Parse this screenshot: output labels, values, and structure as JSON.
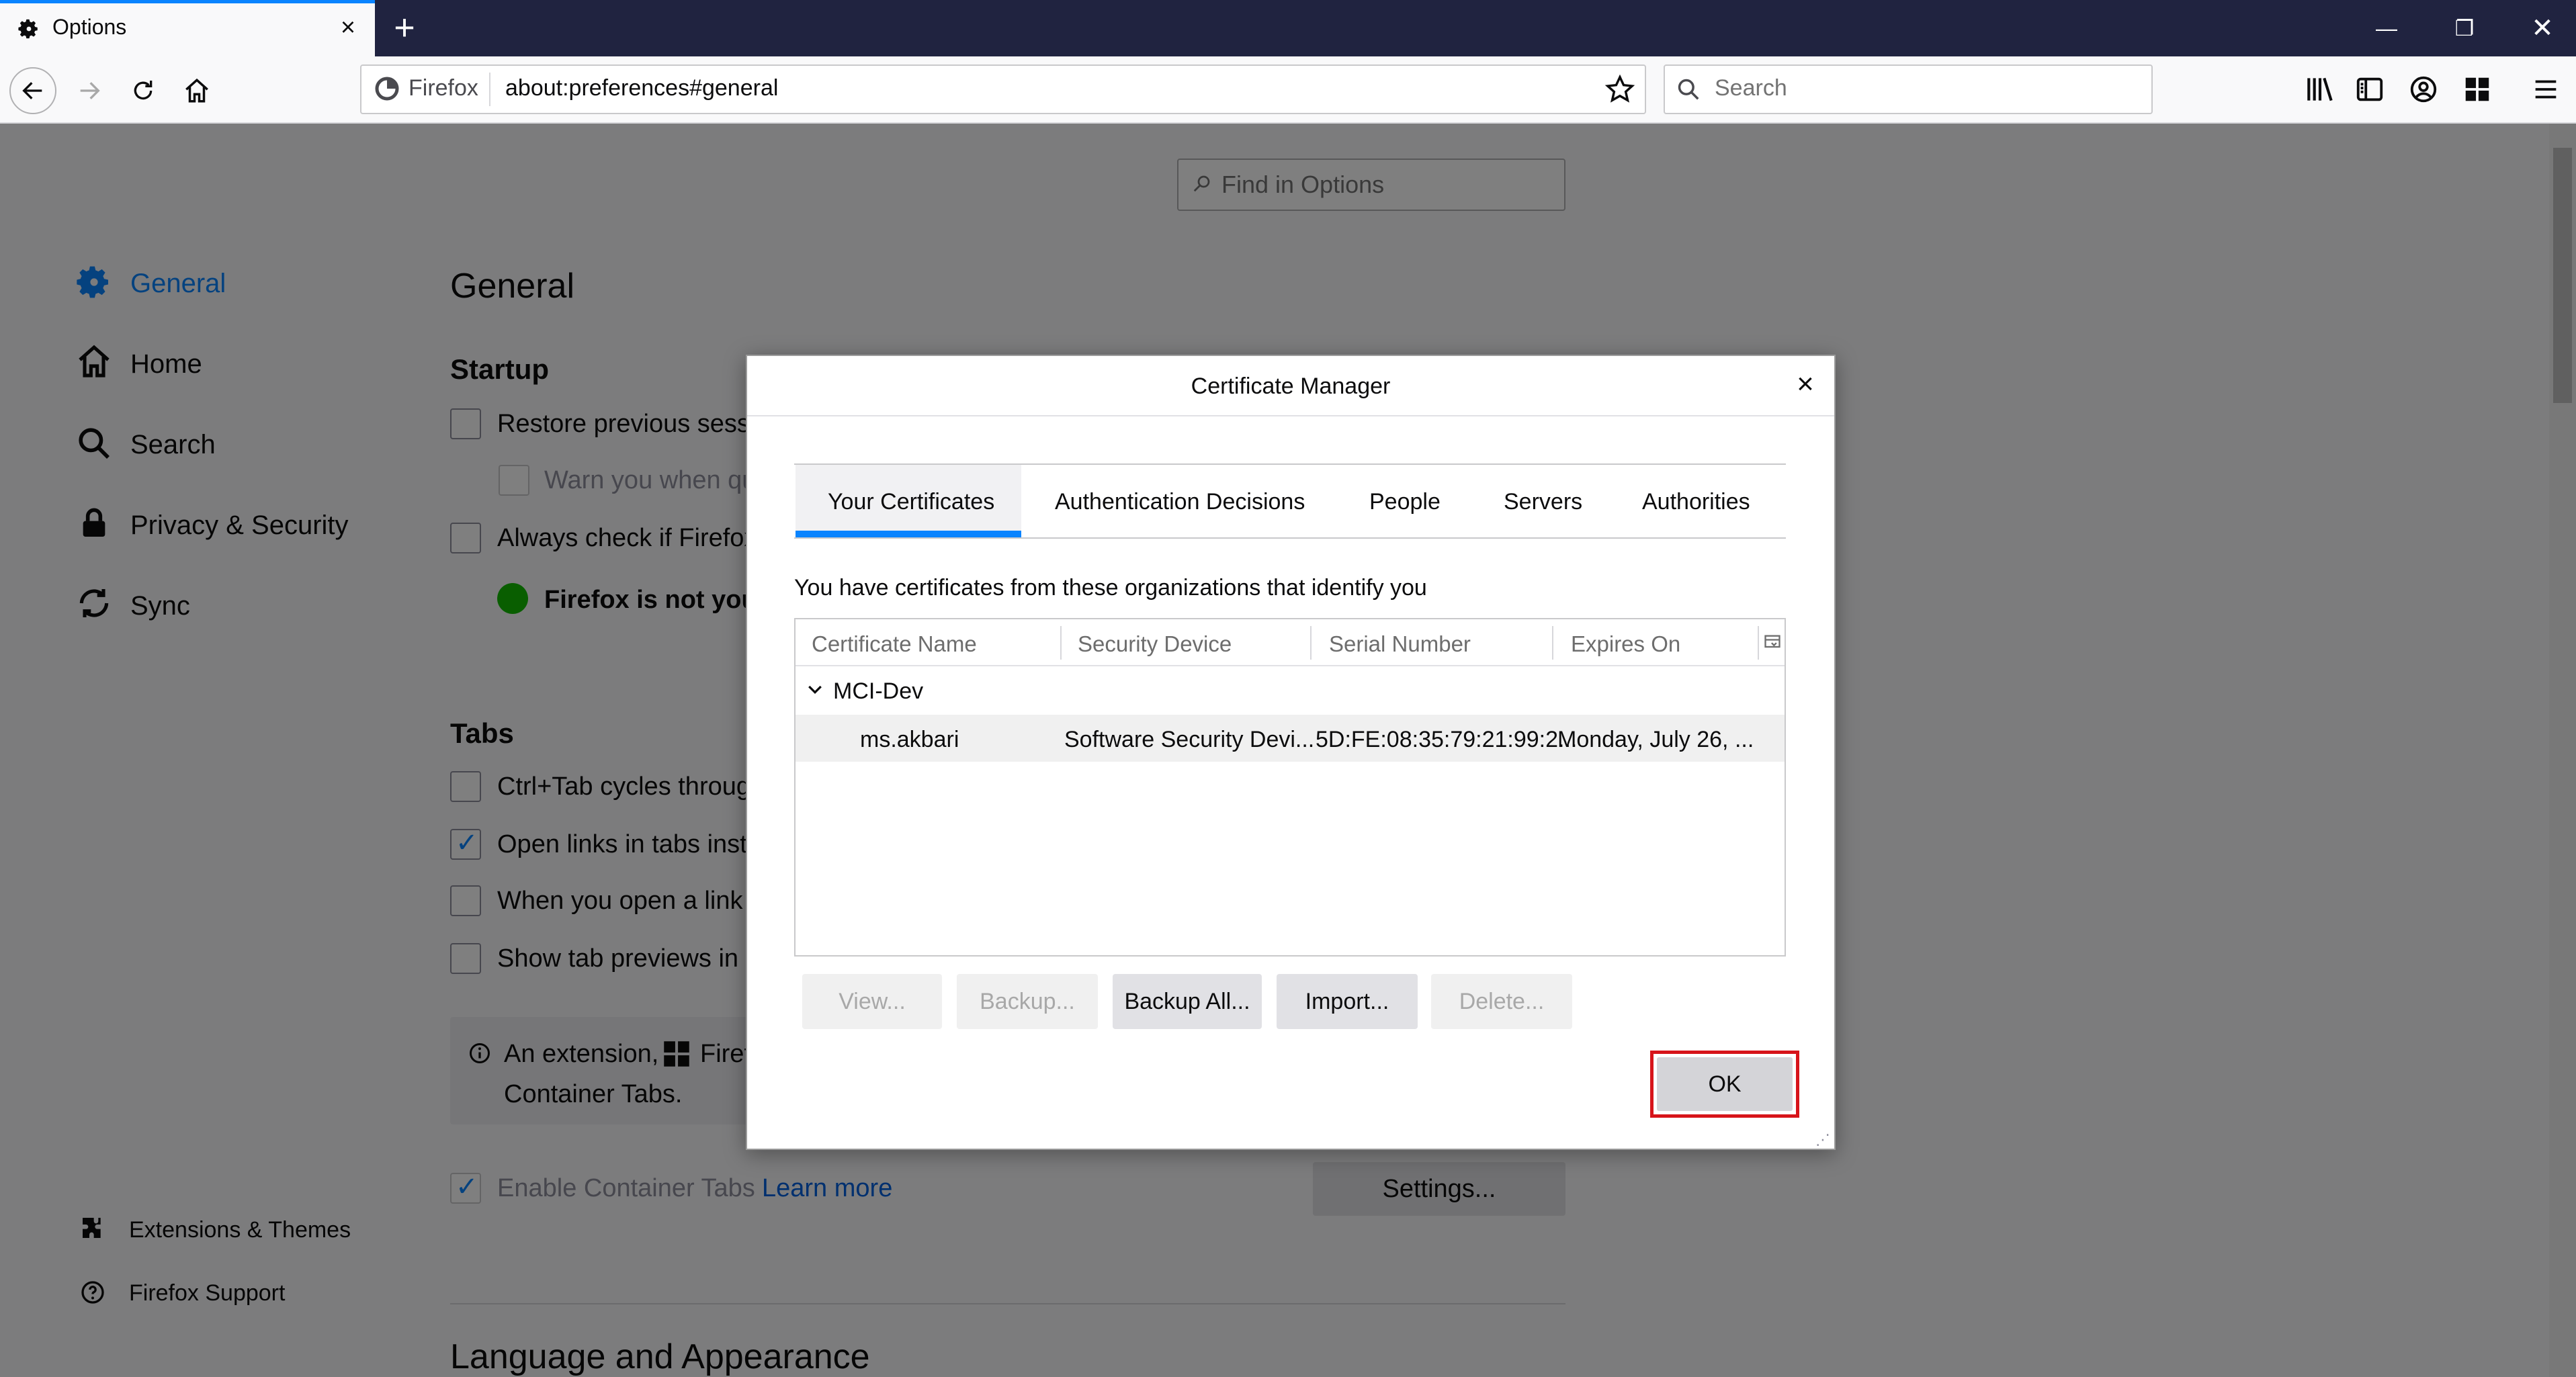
{
  "browser": {
    "tab_title": "Options",
    "identity_label": "Firefox",
    "url": "about:preferences#general",
    "search_placeholder": "Search"
  },
  "page": {
    "find_placeholder": "Find in Options",
    "categories": [
      "General",
      "Home",
      "Search",
      "Privacy & Security",
      "Sync"
    ],
    "footer_links": [
      "Extensions & Themes",
      "Firefox Support"
    ],
    "heading": "General",
    "startup_heading": "Startup",
    "restore_label": "Restore previous sessi",
    "warn_label": "Warn you when qu",
    "always_check_label": "Always check if Firefox",
    "not_default_label": "Firefox is not your",
    "tabs_heading": "Tabs",
    "ctrl_tab_label": "Ctrl+Tab cycles throug",
    "open_links_label": "Open links in tabs inste",
    "when_open_label": "When you open a link",
    "show_previews_label": "Show tab previews in t",
    "notice_line1": "An extension,",
    "notice_firefox": "Firef",
    "notice_line2": "Container Tabs.",
    "enable_container_label": "Enable Container Tabs",
    "learn_more": "Learn more",
    "settings_button": "Settings...",
    "language_heading": "Language and Appearance"
  },
  "dialog": {
    "title": "Certificate Manager",
    "tabs": [
      "Your Certificates",
      "Authentication Decisions",
      "People",
      "Servers",
      "Authorities"
    ],
    "selected_tab": "Your Certificates",
    "description": "You have certificates from these organizations that identify you",
    "columns": [
      "Certificate Name",
      "Security Device",
      "Serial Number",
      "Expires On"
    ],
    "group": "MCI-Dev",
    "row": {
      "name": "ms.akbari",
      "device": "Software Security Devi...",
      "serial": "5D:FE:08:35:79:21:99:2...",
      "expires": "Monday, July 26, ..."
    },
    "buttons": {
      "view": "View...",
      "backup": "Backup...",
      "backup_all": "Backup All...",
      "import": "Import...",
      "delete": "Delete..."
    },
    "ok_label": "OK"
  },
  "colors": {
    "accent": "#0a84ff",
    "highlight": "#d7141a",
    "titlebar": "#202340"
  }
}
